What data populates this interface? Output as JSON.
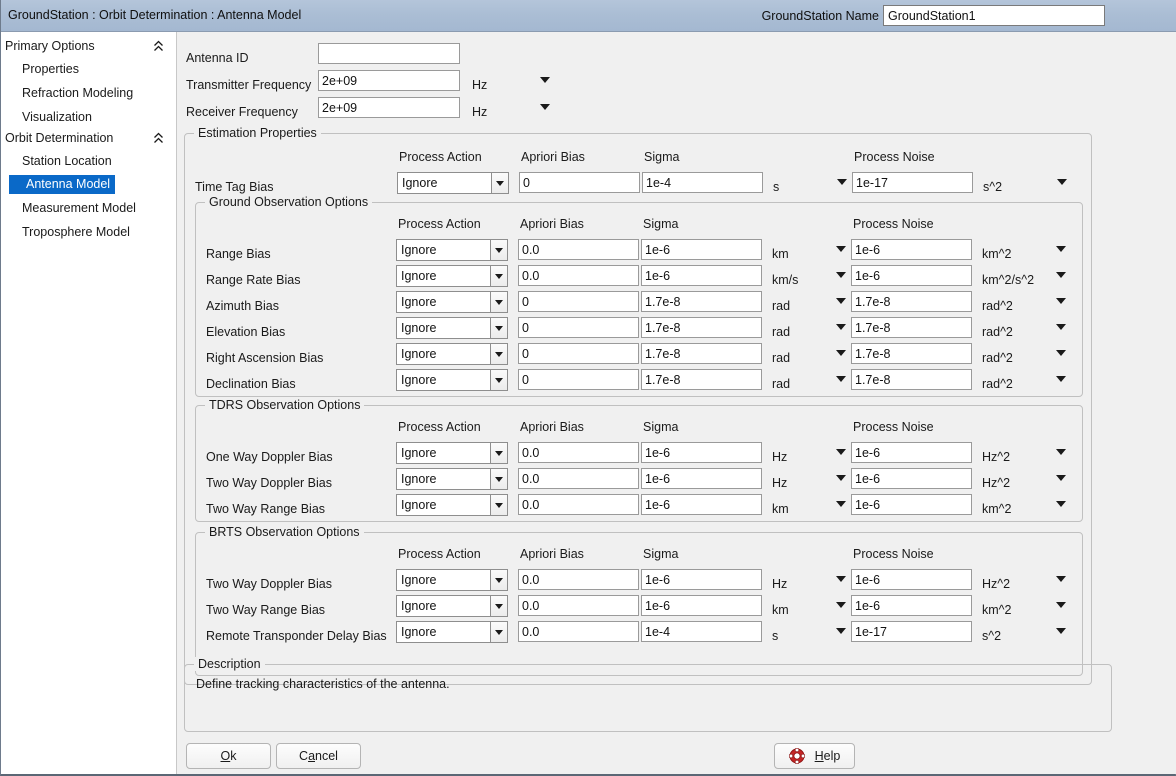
{
  "window": {
    "title": "GroundStation : Orbit Determination : Antenna Model",
    "name_label": "GroundStation Name",
    "name_value": "GroundStation1"
  },
  "sidebar": {
    "groups": [
      {
        "label": "Primary Options",
        "icon": "chevron-double-up-icon",
        "items": [
          "Properties",
          "Refraction Modeling",
          "Visualization"
        ]
      },
      {
        "label": "Orbit Determination",
        "icon": "chevron-double-up-icon",
        "items": [
          "Station Location",
          "Antenna Model",
          "Measurement Model",
          "Troposphere Model"
        ]
      }
    ],
    "selected": "Antenna Model"
  },
  "top_fields": [
    {
      "label": "Antenna ID",
      "value": "",
      "unit": null,
      "has_unit_dropdown": false
    },
    {
      "label": "Transmitter Frequency",
      "value": "2e+09",
      "unit": "Hz",
      "has_unit_dropdown": true
    },
    {
      "label": "Receiver Frequency",
      "value": "2e+09",
      "unit": "Hz",
      "has_unit_dropdown": true
    }
  ],
  "columns": {
    "process_action": "Process Action",
    "apriori_bias": "Apriori Bias",
    "sigma": "Sigma",
    "process_noise": "Process Noise"
  },
  "estimation": {
    "title": "Estimation Properties",
    "rows": [
      {
        "label": "Time Tag Bias",
        "action": "Ignore",
        "apriori": "0",
        "sigma": "1e-4",
        "sigma_unit": "s",
        "noise": "1e-17",
        "noise_unit": "s^2"
      }
    ]
  },
  "ground": {
    "title": "Ground Observation Options",
    "rows": [
      {
        "label": "Range Bias",
        "action": "Ignore",
        "apriori": "0.0",
        "sigma": "1e-6",
        "sigma_unit": "km",
        "noise": "1e-6",
        "noise_unit": "km^2"
      },
      {
        "label": "Range Rate Bias",
        "action": "Ignore",
        "apriori": "0.0",
        "sigma": "1e-6",
        "sigma_unit": "km/s",
        "noise": "1e-6",
        "noise_unit": "km^2/s^2"
      },
      {
        "label": "Azimuth Bias",
        "action": "Ignore",
        "apriori": "0",
        "sigma": "1.7e-8",
        "sigma_unit": "rad",
        "noise": "1.7e-8",
        "noise_unit": "rad^2"
      },
      {
        "label": "Elevation Bias",
        "action": "Ignore",
        "apriori": "0",
        "sigma": "1.7e-8",
        "sigma_unit": "rad",
        "noise": "1.7e-8",
        "noise_unit": "rad^2"
      },
      {
        "label": "Right Ascension Bias",
        "action": "Ignore",
        "apriori": "0",
        "sigma": "1.7e-8",
        "sigma_unit": "rad",
        "noise": "1.7e-8",
        "noise_unit": "rad^2"
      },
      {
        "label": "Declination Bias",
        "action": "Ignore",
        "apriori": "0",
        "sigma": "1.7e-8",
        "sigma_unit": "rad",
        "noise": "1.7e-8",
        "noise_unit": "rad^2"
      }
    ]
  },
  "tdrs": {
    "title": "TDRS Observation Options",
    "rows": [
      {
        "label": "One Way Doppler Bias",
        "action": "Ignore",
        "apriori": "0.0",
        "sigma": "1e-6",
        "sigma_unit": "Hz",
        "noise": "1e-6",
        "noise_unit": "Hz^2"
      },
      {
        "label": "Two Way Doppler Bias",
        "action": "Ignore",
        "apriori": "0.0",
        "sigma": "1e-6",
        "sigma_unit": "Hz",
        "noise": "1e-6",
        "noise_unit": "Hz^2"
      },
      {
        "label": "Two Way Range Bias",
        "action": "Ignore",
        "apriori": "0.0",
        "sigma": "1e-6",
        "sigma_unit": "km",
        "noise": "1e-6",
        "noise_unit": "km^2"
      }
    ]
  },
  "brts": {
    "title": "BRTS Observation Options",
    "rows": [
      {
        "label": "Two Way Doppler Bias",
        "action": "Ignore",
        "apriori": "0.0",
        "sigma": "1e-6",
        "sigma_unit": "Hz",
        "noise": "1e-6",
        "noise_unit": "Hz^2"
      },
      {
        "label": "Two Way Range Bias",
        "action": "Ignore",
        "apriori": "0.0",
        "sigma": "1e-6",
        "sigma_unit": "km",
        "noise": "1e-6",
        "noise_unit": "km^2"
      },
      {
        "label": "Remote Transponder Delay Bias",
        "action": "Ignore",
        "apriori": "0.0",
        "sigma": "1e-4",
        "sigma_unit": "s",
        "noise": "1e-17",
        "noise_unit": "s^2"
      }
    ]
  },
  "description": {
    "title": "Description",
    "text": "Define tracking characteristics of the antenna."
  },
  "buttons": {
    "ok": "Ok",
    "cancel": "Cancel",
    "help": "Help",
    "help_icon": "lifebuoy-icon"
  },
  "colors": {
    "titlebar": "#aabdd4",
    "selection": "#0a69c8",
    "panel": "#f0f0f0",
    "field": "#ffffff",
    "groupbox_border": "#c0c0c0"
  }
}
